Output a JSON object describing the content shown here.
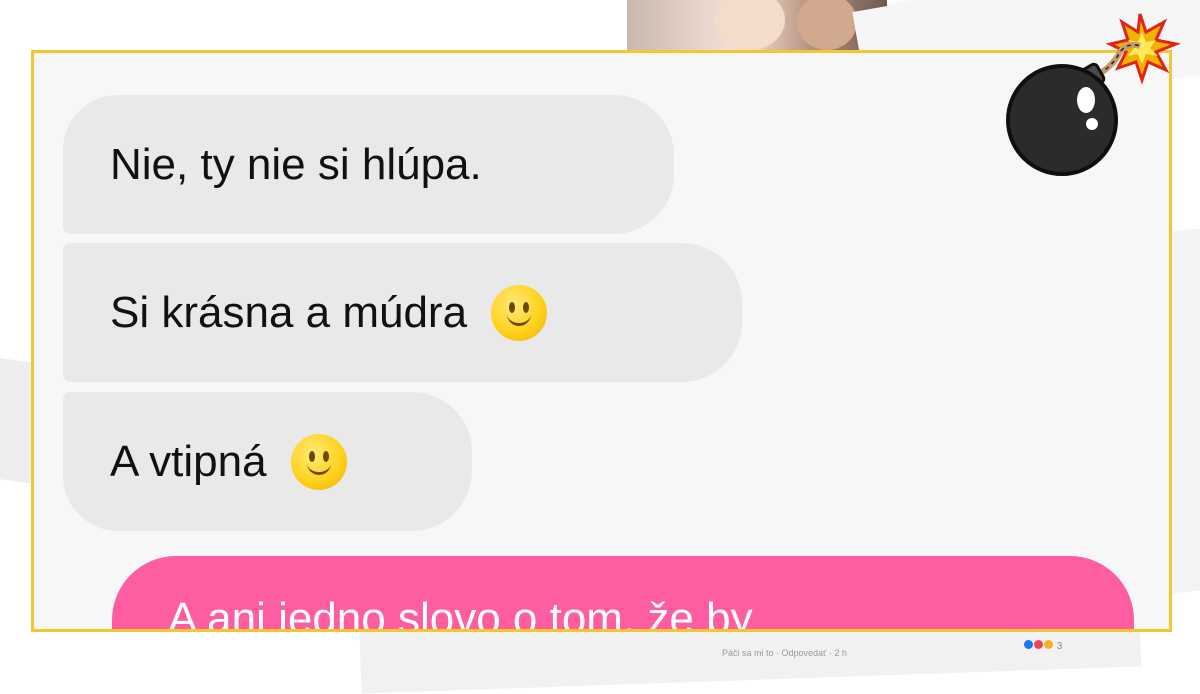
{
  "chat": {
    "received_messages": [
      {
        "text": "Nie, ty nie si hlúpa.",
        "emoji": ""
      },
      {
        "text": "Si krásna a múdra",
        "emoji": "slightly-smiling-face"
      },
      {
        "text": "A vtipná",
        "emoji": "slightly-smiling-face"
      }
    ],
    "sent_message_partial": "A ani jedno slovo o tom, že by"
  },
  "background": {
    "footer_text": "Páči sa mi to · Odpovedať · 2 h",
    "reaction_count": "3"
  },
  "colors": {
    "frame_border": "#f7c52e",
    "received_bubble": "#e9e9e9",
    "sent_bubble": "#fe5da1"
  },
  "icons": [
    "bomb-icon",
    "slightly-smiling-face"
  ]
}
